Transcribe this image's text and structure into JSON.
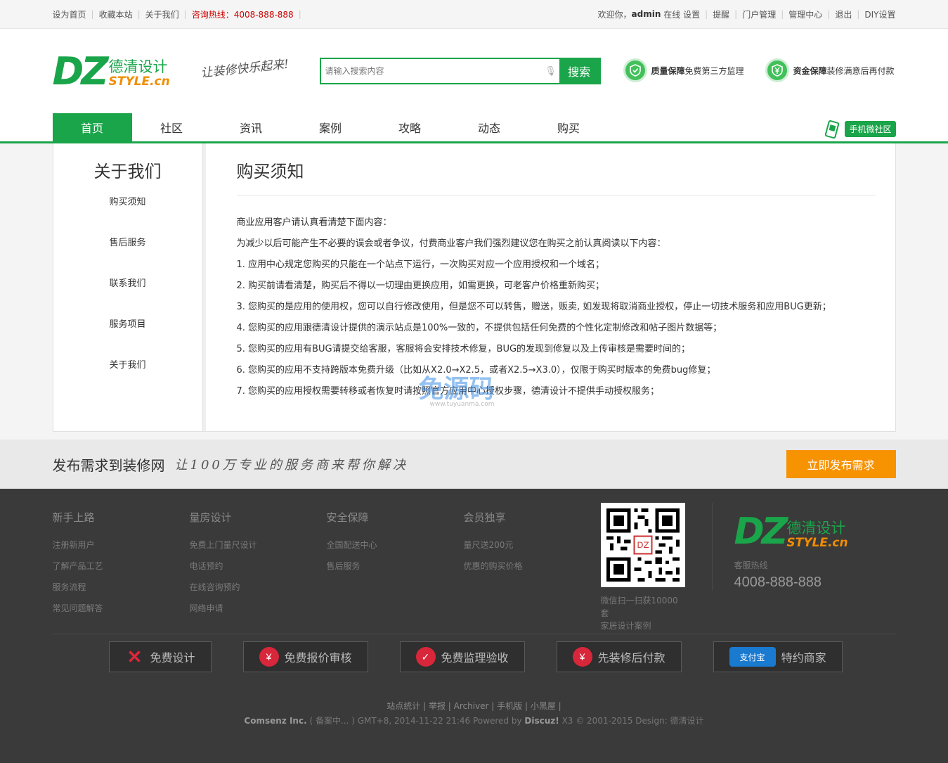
{
  "topbar": {
    "left": [
      "设为首页",
      "收藏本站",
      "关于我们"
    ],
    "hotline": "咨询热线：4008-888-888",
    "welcome": "欢迎你，",
    "username": "admin",
    "status": "在线",
    "settings": "设置",
    "right": [
      "提醒",
      "门户管理",
      "管理中心",
      "退出",
      "DIY设置"
    ]
  },
  "header": {
    "logo_dz": "DZ",
    "logo_cn": "德清设计",
    "logo_en": "STYLE.cn",
    "slogan": "让装修快乐起来!",
    "search_placeholder": "请输入搜索内容",
    "search_button": "搜索",
    "guarantee1_bold": "质量保障",
    "guarantee1_text": "免费第三方监理",
    "guarantee2_bold": "资金保障",
    "guarantee2_text": "装修满意后再付款"
  },
  "nav": {
    "items": [
      "首页",
      "社区",
      "资讯",
      "案例",
      "攻略",
      "动态",
      "购买"
    ],
    "mobile": "手机微社区"
  },
  "sidebar": {
    "title": "关于我们",
    "items": [
      "购买须知",
      "售后服务",
      "联系我们",
      "服务项目",
      "关于我们"
    ]
  },
  "main": {
    "title": "购买须知",
    "lines": [
      "商业应用客户请认真看清楚下面内容：",
      "为减少以后可能产生不必要的误会或者争议，付费商业客户我们强烈建议您在购买之前认真阅读以下内容：",
      "1. 应用中心规定您购买的只能在一个站点下运行，一次购买对应一个应用授权和一个域名；",
      "2. 购买前请看清楚，购买后不得以一切理由更换应用，如需更换，可老客户价格重新购买；",
      "3. 您购买的是应用的使用权，您可以自行修改使用，但是您不可以转售，赠送，贩卖, 如发现将取消商业授权，停止一切技术服务和应用BUG更新；",
      "4. 您购买的应用跟德清设计提供的演示站点是100%一致的，不提供包括任何免费的个性化定制修改和帖子图片数据等；",
      "5. 您购买的应用有BUG请提交给客服，客服将会安排技术修复，BUG的发现到修复以及上传审核是需要时间的；",
      "6. 您购买的应用不支持跨版本免费升级（比如从X2.0→X2.5，或者X2.5→X3.0），仅限于购买时版本的免费bug修复；",
      "7. 您购买的应用授权需要转移或者恢复时请按照官方应用中心授权步骤，德清设计不提供手动授权服务；"
    ],
    "watermark": "免源码",
    "watermark_url": "www.tuyuanma.com"
  },
  "banner": {
    "title": "发布需求到装修网",
    "subtitle": "让100万专业的服务商来帮你解决",
    "button": "立即发布需求"
  },
  "footer": {
    "cols": [
      {
        "title": "新手上路",
        "links": [
          "注册新用户",
          "了解产品工艺",
          "服务流程",
          "常见问题解答"
        ]
      },
      {
        "title": "量房设计",
        "links": [
          "免费上门量尺设计",
          "电话预约",
          "在线咨询预约",
          "网络申请"
        ]
      },
      {
        "title": "安全保障",
        "links": [
          "全国配送中心",
          "售后服务"
        ]
      },
      {
        "title": "会员独享",
        "links": [
          "量尺送200元",
          "优惠的购买价格"
        ]
      }
    ],
    "qr_caption1": "微信扫一扫获10000套",
    "qr_caption2": "家居设计案例",
    "hotline_label": "客服热线",
    "hotline": "4008-888-888",
    "services": [
      "免费设计",
      "免费报价审核",
      "免费监理验收",
      "先装修后付款",
      "特约商家"
    ],
    "alipay": "支付宝",
    "links": [
      "站点统计",
      "举报",
      "Archiver",
      "手机版",
      "小黑屋"
    ],
    "copy_company": "Comsenz Inc.",
    "copy_icp": "( 备案中... )",
    "copy_time": "GMT+8, 2014-11-22 21:46 Powered by",
    "copy_discuz": "Discuz!",
    "copy_ver": "X3 © 2001-2015   Design: 德清设计"
  }
}
